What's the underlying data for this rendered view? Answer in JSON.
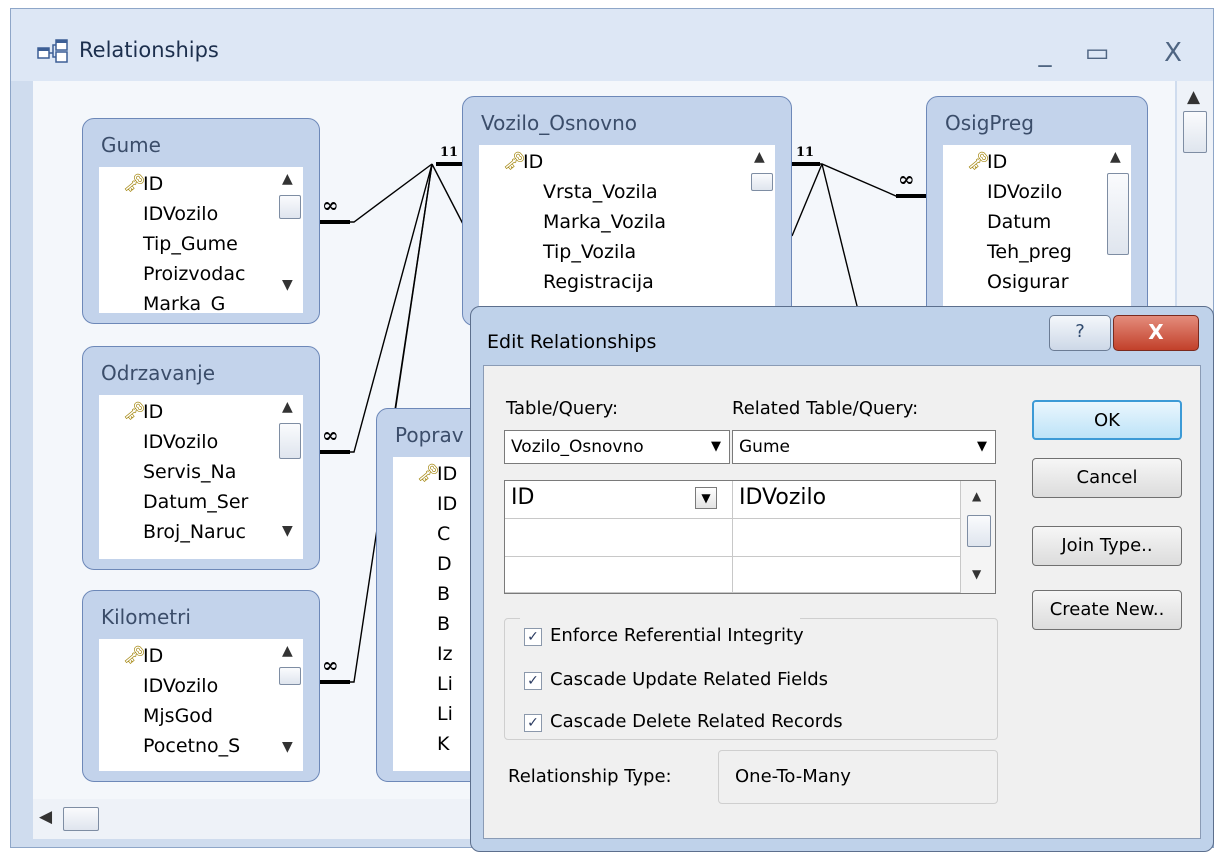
{
  "window": {
    "title": "Relationships",
    "min_symbol": "_",
    "max_symbol": "▭",
    "close_symbol": "X"
  },
  "tables": {
    "gume": {
      "title": "Gume",
      "fields": [
        "ID",
        "IDVozilo",
        "Tip_Gume",
        "Proizvodac",
        "Marka_G"
      ]
    },
    "odrzavanje": {
      "title": "Odrzavanje",
      "fields": [
        "ID",
        "IDVozilo",
        "Servis_Na",
        "Datum_Ser",
        "Broj_Naruc"
      ]
    },
    "kilometri": {
      "title": "Kilometri",
      "fields": [
        "ID",
        "IDVozilo",
        "MjsGod",
        "Pocetno_S"
      ]
    },
    "vozilo_osnovno": {
      "title": "Vozilo_Osnovno",
      "fields": [
        "ID",
        "Vrsta_Vozila",
        "Marka_Vozila",
        "Tip_Vozila",
        "Registracija"
      ]
    },
    "osigpreg": {
      "title": "OsigPreg",
      "fields": [
        "ID",
        "IDVozilo",
        "Datum",
        "Teh_preg",
        "Osigurar"
      ]
    },
    "popravci": {
      "title": "Poprav",
      "fields": [
        "ID",
        "ID",
        "C",
        "D",
        "B",
        "B",
        "Iz",
        "Li",
        "Li",
        "K"
      ]
    }
  },
  "relations": {
    "one_symbol": "1",
    "many_symbol": "∞"
  },
  "dialog": {
    "title": "Edit Relationships",
    "help_label": "?",
    "close_label": "X",
    "table_query_label": "Table/Query:",
    "related_table_label": "Related Table/Query:",
    "table_query_value": "Vozilo_Osnovno",
    "related_table_value": "Gume",
    "grid_rows": [
      {
        "left": "ID",
        "right": "IDVozilo"
      },
      {
        "left": "",
        "right": ""
      },
      {
        "left": "",
        "right": ""
      }
    ],
    "enforce_label": "Enforce Referential Integrity",
    "cascade_update_label": "Cascade Update Related Fields",
    "cascade_delete_label": "Cascade Delete Related Records",
    "enforce_checked": true,
    "cascade_update_checked": true,
    "cascade_delete_checked": true,
    "relationship_type_label": "Relationship Type:",
    "relationship_type_value": "One-To-Many",
    "ok_label": "OK",
    "cancel_label": "Cancel",
    "join_type_label": "Join Type..",
    "create_new_label": "Create New.."
  }
}
